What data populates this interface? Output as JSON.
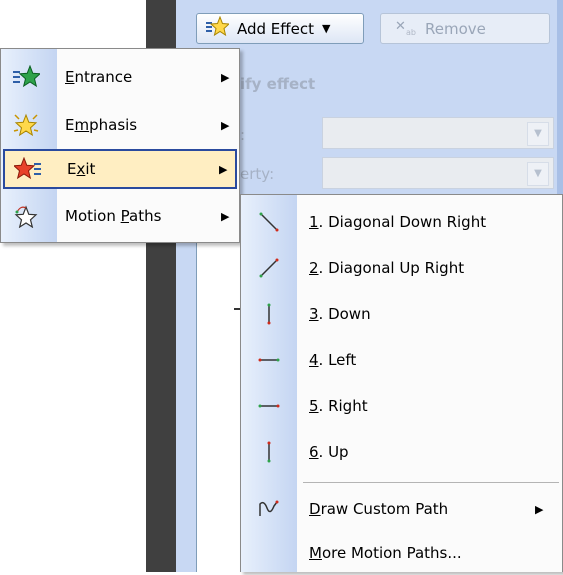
{
  "toolbar": {
    "add_effect_label": "Add Effect",
    "remove_label": "Remove"
  },
  "pane": {
    "modify_heading_partial": "ify effect",
    "property_label_1_partial": ":",
    "property_label_2_partial": "erty:"
  },
  "menu": {
    "items": [
      {
        "pre": "",
        "acc": "E",
        "post": "ntrance",
        "icon": "entrance-star-icon"
      },
      {
        "pre": "E",
        "acc": "m",
        "post": "phasis",
        "icon": "emphasis-star-icon"
      },
      {
        "pre": "E",
        "acc": "x",
        "post": "it",
        "icon": "exit-star-icon"
      },
      {
        "pre": "Motion ",
        "acc": "P",
        "post": "aths",
        "icon": "motion-path-star-icon"
      }
    ]
  },
  "submenu": {
    "items": [
      {
        "acc": "1",
        "post": ". Diagonal Down Right",
        "icon": "diagonal-down-right-icon"
      },
      {
        "acc": "2",
        "post": ". Diagonal Up Right",
        "icon": "diagonal-up-right-icon"
      },
      {
        "acc": "3",
        "post": ". Down",
        "icon": "down-path-icon"
      },
      {
        "acc": "4",
        "post": ". Left",
        "icon": "left-path-icon"
      },
      {
        "acc": "5",
        "post": ". Right",
        "icon": "right-path-icon"
      },
      {
        "acc": "6",
        "post": ". Up",
        "icon": "up-path-icon"
      },
      {
        "acc": "D",
        "post": "raw Custom Path",
        "icon": "custom-path-icon"
      },
      {
        "acc": "M",
        "post": "ore Motion Paths...",
        "icon": ""
      }
    ]
  },
  "colors": {
    "highlight_bg": "#ffeec2",
    "highlight_border": "#2a4a9e",
    "pane_bg": "#c8d8f3"
  }
}
